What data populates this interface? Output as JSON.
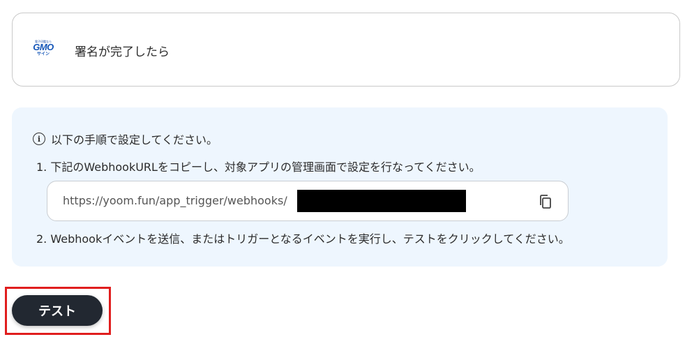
{
  "trigger": {
    "logo": {
      "tagline": "電子印鑑なら",
      "brand": "GMO",
      "product": "サイン"
    },
    "title": "署名が完了したら"
  },
  "instructions": {
    "heading": "以下の手順で設定してください。",
    "step1": "1. 下記のWebhookURLをコピーし、対象アプリの管理画面で設定を行なってください。",
    "webhook_url": "https://yoom.fun/app_trigger/webhooks/",
    "step2": "2. Webhookイベントを送信、またはトリガーとなるイベントを実行し、テストをクリックしてください。"
  },
  "actions": {
    "test_label": "テスト"
  },
  "colors": {
    "info_bg": "#eef6fe",
    "button_bg": "#222831",
    "highlight": "#e01e1e"
  }
}
